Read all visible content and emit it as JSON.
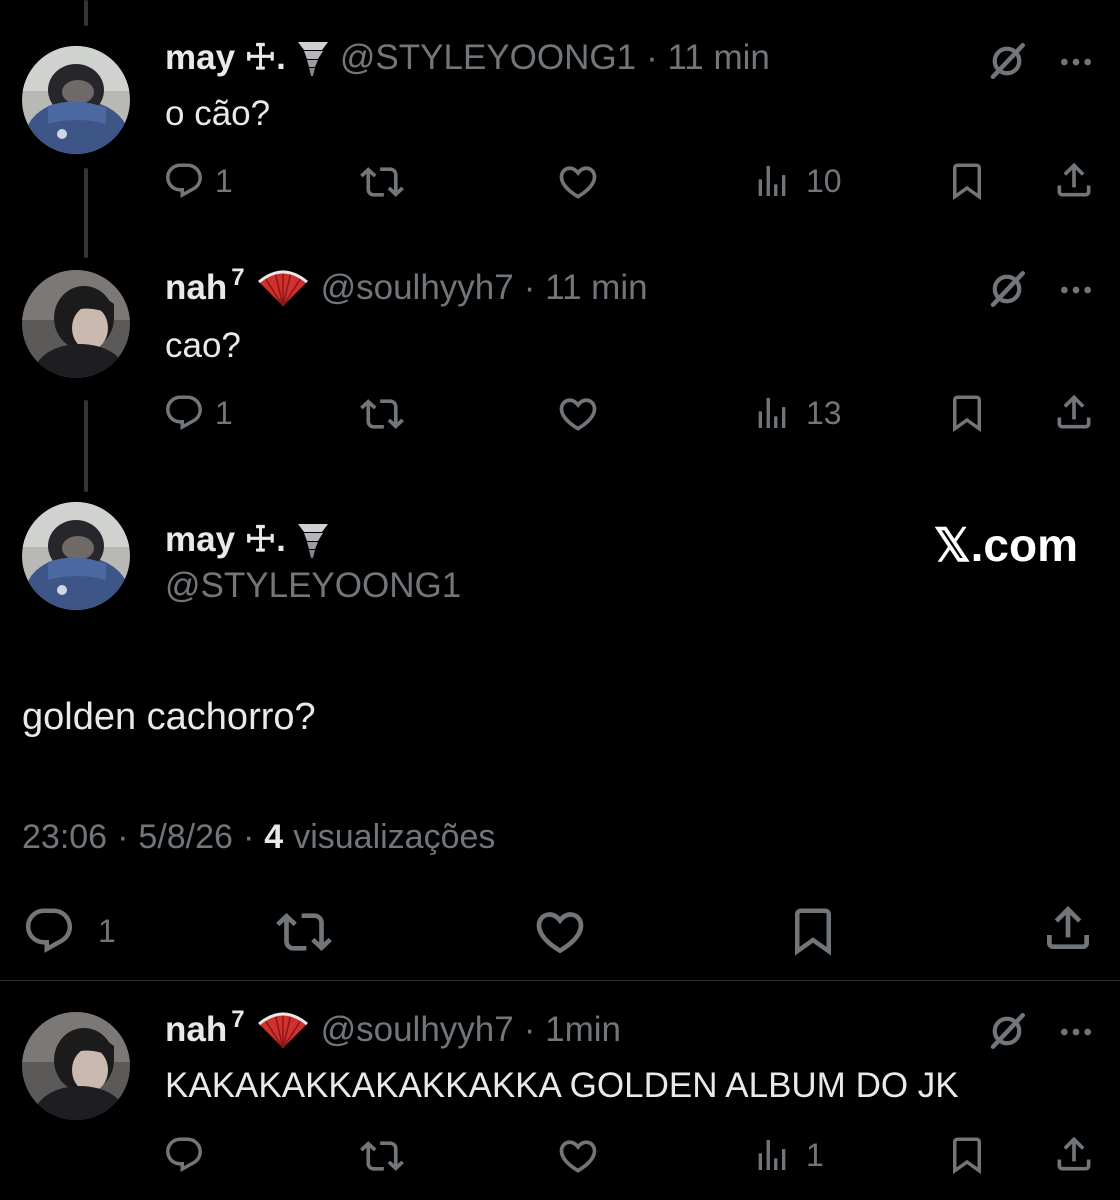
{
  "thread": [
    {
      "name": "may ☩.",
      "name_emoji": "tornado-emoji",
      "handle": "@STYLEYOONG1",
      "time": "· 11 min",
      "text": "o cão?",
      "replies": "1",
      "views": "10"
    },
    {
      "name": "nah",
      "name_sup": "7",
      "name_emoji": "fan-emoji",
      "handle": "@soulhyyh7",
      "time": "· 11 min",
      "text": "cao?",
      "replies": "1",
      "views": "13"
    }
  ],
  "main": {
    "name": "may ☩.",
    "name_emoji": "tornado-emoji",
    "handle": "@STYLEYOONG1",
    "brand": "𝕏.com",
    "text": "golden cachorro?",
    "time": "23:06",
    "date": "5/8/26",
    "views_count": "4",
    "views_label": "visualizações",
    "replies": "1"
  },
  "reply": {
    "name": "nah",
    "name_sup": "7",
    "name_emoji": "fan-emoji",
    "handle": "@soulhyyh7",
    "time": "· 1min",
    "text": "KAKAKAKKAKAKKAKKA GOLDEN ALBUM DO JK",
    "views": "1"
  },
  "colors": {
    "background": "#000000",
    "text": "#e7e9ea",
    "secondary": "#71767b",
    "divider": "#2f3336"
  }
}
